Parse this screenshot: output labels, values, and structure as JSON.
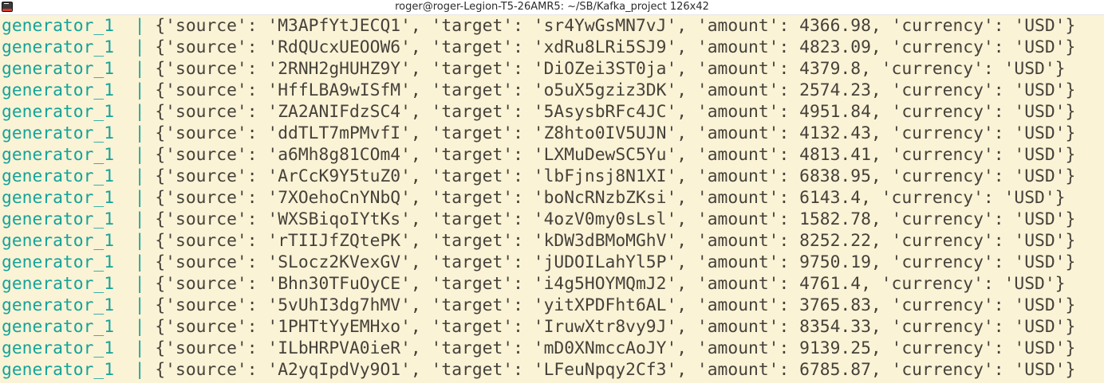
{
  "window": {
    "title": "roger@roger-Legion-T5-26AMR5: ~/SB/Kafka_project 126x42",
    "icon": "terminal-icon"
  },
  "terminal": {
    "colors": {
      "background": "#fbf3d6",
      "text": "#46413a",
      "service": "#15a39a"
    },
    "lines": [
      {
        "service": "generator_1",
        "pipe": "|",
        "message": "{'source': 'M3APfYtJECQ1', 'target': 'sr4YwGsMN7vJ', 'amount': 4366.98, 'currency': 'USD'}"
      },
      {
        "service": "generator_1",
        "pipe": "|",
        "message": "{'source': 'RdQUcxUEOOW6', 'target': 'xdRu8LRi5SJ9', 'amount': 4823.09, 'currency': 'USD'}"
      },
      {
        "service": "generator_1",
        "pipe": "|",
        "message": "{'source': '2RNH2gHUHZ9Y', 'target': 'DiOZei3ST0ja', 'amount': 4379.8, 'currency': 'USD'}"
      },
      {
        "service": "generator_1",
        "pipe": "|",
        "message": "{'source': 'HffLBA9wISfM', 'target': 'o5uX5gziz3DK', 'amount': 2574.23, 'currency': 'USD'}"
      },
      {
        "service": "generator_1",
        "pipe": "|",
        "message": "{'source': 'ZA2ANIFdzSC4', 'target': '5AsysbRFc4JC', 'amount': 4951.84, 'currency': 'USD'}"
      },
      {
        "service": "generator_1",
        "pipe": "|",
        "message": "{'source': 'ddTLT7mPMvfI', 'target': 'Z8hto0IV5UJN', 'amount': 4132.43, 'currency': 'USD'}"
      },
      {
        "service": "generator_1",
        "pipe": "|",
        "message": "{'source': 'a6Mh8g81COm4', 'target': 'LXMuDewSC5Yu', 'amount': 4813.41, 'currency': 'USD'}"
      },
      {
        "service": "generator_1",
        "pipe": "|",
        "message": "{'source': 'ArCcK9Y5tuZ0', 'target': 'lbFjnsj8N1XI', 'amount': 6838.95, 'currency': 'USD'}"
      },
      {
        "service": "generator_1",
        "pipe": "|",
        "message": "{'source': '7XOehoCnYNbQ', 'target': 'boNcRNzbZKsi', 'amount': 6143.4, 'currency': 'USD'}"
      },
      {
        "service": "generator_1",
        "pipe": "|",
        "message": "{'source': 'WXSBiqoIYtKs', 'target': '4ozV0my0sLsl', 'amount': 1582.78, 'currency': 'USD'}"
      },
      {
        "service": "generator_1",
        "pipe": "|",
        "message": "{'source': 'rTIIJfZQtePK', 'target': 'kDW3dBMoMGhV', 'amount': 8252.22, 'currency': 'USD'}"
      },
      {
        "service": "generator_1",
        "pipe": "|",
        "message": "{'source': 'SLocz2KVexGV', 'target': 'jUDOILahYl5P', 'amount': 9750.19, 'currency': 'USD'}"
      },
      {
        "service": "generator_1",
        "pipe": "|",
        "message": "{'source': 'Bhn30TFuOyCE', 'target': 'i4g5HOYMQmJ2', 'amount': 4761.4, 'currency': 'USD'}"
      },
      {
        "service": "generator_1",
        "pipe": "|",
        "message": "{'source': '5vUhI3dg7hMV', 'target': 'yitXPDFht6AL', 'amount': 3765.83, 'currency': 'USD'}"
      },
      {
        "service": "generator_1",
        "pipe": "|",
        "message": "{'source': '1PHTtYyEMHxo', 'target': 'IruwXtr8vy9J', 'amount': 8354.33, 'currency': 'USD'}"
      },
      {
        "service": "generator_1",
        "pipe": "|",
        "message": "{'source': 'ILbHRPVA0ieR', 'target': 'mD0XNmccAoJY', 'amount': 9139.25, 'currency': 'USD'}"
      },
      {
        "service": "generator_1",
        "pipe": "|",
        "message": "{'source': 'A2yqIpdVy9O1', 'target': 'LFeuNpqy2Cf3', 'amount': 6785.87, 'currency': 'USD'}"
      }
    ]
  }
}
